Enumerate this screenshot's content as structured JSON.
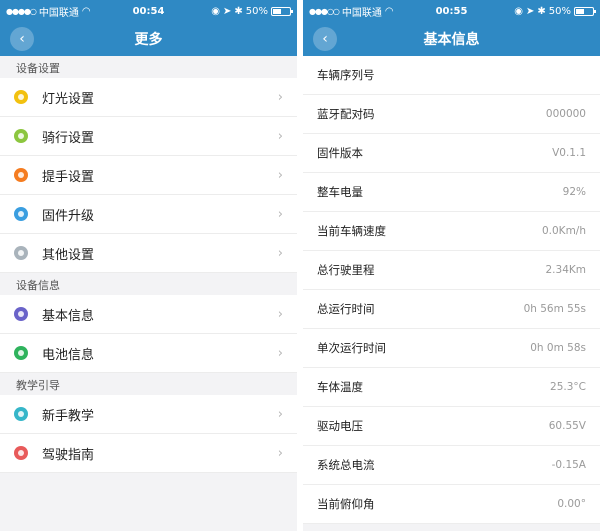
{
  "colors": {
    "header": "#2f89c4"
  },
  "left": {
    "status": {
      "carrier": "中国联通",
      "time": "00:54",
      "battery": "50%",
      "battery_level": 0.5
    },
    "title": "更多",
    "sections": [
      {
        "title": "设备设置",
        "items": [
          {
            "label": "灯光设置",
            "icon": "bulb-icon",
            "color": "#f2c10f"
          },
          {
            "label": "骑行设置",
            "icon": "ride-icon",
            "color": "#8cc63f"
          },
          {
            "label": "提手设置",
            "icon": "handle-icon",
            "color": "#f57c20"
          },
          {
            "label": "固件升级",
            "icon": "upgrade-icon",
            "color": "#3a9ee0"
          },
          {
            "label": "其他设置",
            "icon": "gear-icon",
            "color": "#a9b3bb"
          }
        ]
      },
      {
        "title": "设备信息",
        "items": [
          {
            "label": "基本信息",
            "icon": "info-icon",
            "color": "#6a63c9"
          },
          {
            "label": "电池信息",
            "icon": "battery-icon",
            "color": "#2fb35d"
          }
        ]
      },
      {
        "title": "教学引导",
        "items": [
          {
            "label": "新手教学",
            "icon": "book-icon",
            "color": "#36b6c9"
          },
          {
            "label": "驾驶指南",
            "icon": "guide-icon",
            "color": "#e85a5a"
          }
        ]
      }
    ]
  },
  "right": {
    "status": {
      "carrier": "中国联通",
      "time": "00:55",
      "battery": "50%",
      "battery_level": 0.5
    },
    "title": "基本信息",
    "rows": [
      {
        "key": "车辆序列号",
        "value": ""
      },
      {
        "key": "蓝牙配对码",
        "value": "000000"
      },
      {
        "key": "固件版本",
        "value": "V0.1.1"
      },
      {
        "key": "整车电量",
        "value": "92%"
      },
      {
        "key": "当前车辆速度",
        "value": "0.0Km/h"
      },
      {
        "key": "总行驶里程",
        "value": "2.34Km"
      },
      {
        "key": "总运行时间",
        "value": "0h 56m 55s"
      },
      {
        "key": "单次运行时间",
        "value": "0h 0m 58s"
      },
      {
        "key": "车体温度",
        "value": "25.3°C"
      },
      {
        "key": "驱动电压",
        "value": "60.55V"
      },
      {
        "key": "系统总电流",
        "value": "-0.15A"
      },
      {
        "key": "当前俯仰角",
        "value": "0.00°"
      }
    ]
  }
}
